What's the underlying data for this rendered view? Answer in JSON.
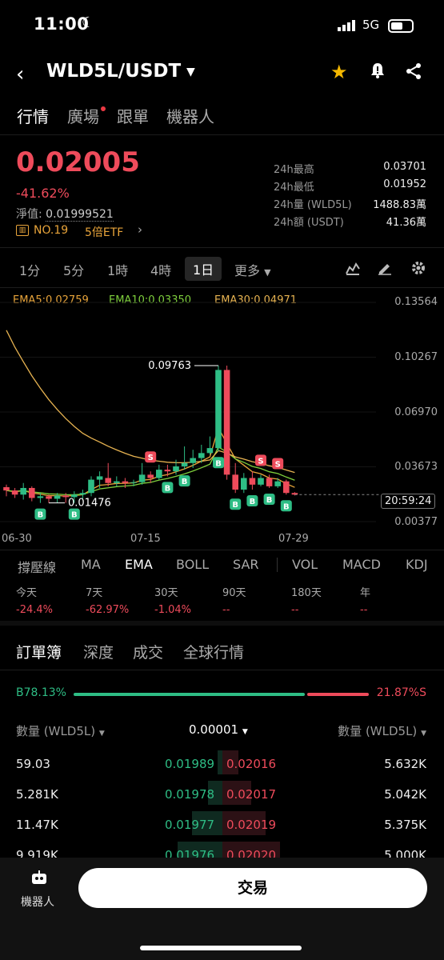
{
  "status_bar": {
    "time": "11:00",
    "network": "5G"
  },
  "header": {
    "pair": "WLD5L/USDT"
  },
  "tabs": [
    {
      "label": "行情",
      "active": true
    },
    {
      "label": "廣場",
      "active": false,
      "dot": true
    },
    {
      "label": "跟單",
      "active": false
    },
    {
      "label": "機器人",
      "active": false
    }
  ],
  "ticker": {
    "price": "0.02005",
    "change": "-41.62%",
    "nav_label": "淨值:",
    "nav_value": "0.01999521",
    "rank": "NO.19",
    "etf": "5倍ETF",
    "stats": [
      {
        "label": "24h最高",
        "value": "0.03701"
      },
      {
        "label": "24h最低",
        "value": "0.01952"
      },
      {
        "label": "24h量 (WLD5L)",
        "value": "1488.83萬"
      },
      {
        "label": "24h額 (USDT)",
        "value": "41.36萬"
      }
    ]
  },
  "intervals": [
    "1分",
    "5分",
    "1時",
    "4時",
    "1日",
    "更多"
  ],
  "active_interval": "1日",
  "chart": {
    "ema_labels": [
      "EMA5:0.02759",
      "EMA10:0.03350",
      "EMA30:0.04971"
    ],
    "ema_colors": [
      "#e8a43a",
      "#7ecf3c",
      "#e7b351"
    ],
    "y_ticks": [
      "0.13564",
      "0.10267",
      "0.06970",
      "0.03673",
      "0.00377"
    ],
    "x_ticks": [
      "06-30",
      "07-15",
      "07-29"
    ],
    "high_label": "0.09763",
    "low_label": "0.01476",
    "countdown": "20:59:24",
    "buy_marker": "B",
    "sell_marker": "S"
  },
  "chart_data": {
    "type": "candlestick",
    "ylim": [
      0.00377,
      0.13564
    ],
    "candles": [
      {
        "o": 0.0245,
        "c": 0.0225,
        "h": 0.026,
        "l": 0.019
      },
      {
        "o": 0.0225,
        "c": 0.02,
        "h": 0.024,
        "l": 0.018
      },
      {
        "o": 0.02,
        "c": 0.024,
        "h": 0.027,
        "l": 0.017
      },
      {
        "o": 0.024,
        "c": 0.018,
        "h": 0.025,
        "l": 0.016
      },
      {
        "o": 0.018,
        "c": 0.019,
        "h": 0.021,
        "l": 0.015
      },
      {
        "o": 0.019,
        "c": 0.0175,
        "h": 0.02,
        "l": 0.015
      },
      {
        "o": 0.0175,
        "c": 0.0195,
        "h": 0.021,
        "l": 0.015
      },
      {
        "o": 0.0195,
        "c": 0.0185,
        "h": 0.021,
        "l": 0.015
      },
      {
        "o": 0.0185,
        "c": 0.02,
        "h": 0.022,
        "l": 0.015
      },
      {
        "o": 0.02,
        "c": 0.021,
        "h": 0.023,
        "l": 0.017
      },
      {
        "o": 0.021,
        "c": 0.029,
        "h": 0.031,
        "l": 0.019
      },
      {
        "o": 0.029,
        "c": 0.031,
        "h": 0.034,
        "l": 0.024
      },
      {
        "o": 0.03,
        "c": 0.027,
        "h": 0.039,
        "l": 0.025
      },
      {
        "o": 0.027,
        "c": 0.028,
        "h": 0.031,
        "l": 0.025
      },
      {
        "o": 0.028,
        "c": 0.027,
        "h": 0.03,
        "l": 0.024
      },
      {
        "o": 0.027,
        "c": 0.0275,
        "h": 0.029,
        "l": 0.025
      },
      {
        "o": 0.0275,
        "c": 0.032,
        "h": 0.039,
        "l": 0.026
      },
      {
        "o": 0.032,
        "c": 0.03,
        "h": 0.034,
        "l": 0.027
      },
      {
        "o": 0.03,
        "c": 0.035,
        "h": 0.038,
        "l": 0.029
      },
      {
        "o": 0.035,
        "c": 0.034,
        "h": 0.038,
        "l": 0.031
      },
      {
        "o": 0.034,
        "c": 0.037,
        "h": 0.041,
        "l": 0.032
      },
      {
        "o": 0.037,
        "c": 0.039,
        "h": 0.049,
        "l": 0.035
      },
      {
        "o": 0.039,
        "c": 0.042,
        "h": 0.047,
        "l": 0.036
      },
      {
        "o": 0.042,
        "c": 0.045,
        "h": 0.05,
        "l": 0.039
      },
      {
        "o": 0.045,
        "c": 0.048,
        "h": 0.055,
        "l": 0.044
      },
      {
        "o": 0.048,
        "c": 0.095,
        "h": 0.0976,
        "l": 0.046
      },
      {
        "o": 0.095,
        "c": 0.032,
        "h": 0.0976,
        "l": 0.029
      },
      {
        "o": 0.032,
        "c": 0.023,
        "h": 0.039,
        "l": 0.021
      },
      {
        "o": 0.023,
        "c": 0.03,
        "h": 0.033,
        "l": 0.021
      },
      {
        "o": 0.03,
        "c": 0.026,
        "h": 0.034,
        "l": 0.023
      },
      {
        "o": 0.026,
        "c": 0.03,
        "h": 0.032,
        "l": 0.025
      },
      {
        "o": 0.03,
        "c": 0.025,
        "h": 0.032,
        "l": 0.024
      },
      {
        "o": 0.025,
        "c": 0.028,
        "h": 0.03,
        "l": 0.024
      },
      {
        "o": 0.028,
        "c": 0.021,
        "h": 0.029,
        "l": 0.02
      },
      {
        "o": 0.021,
        "c": 0.02,
        "h": 0.0215,
        "l": 0.0195
      }
    ]
  },
  "indicators": [
    "撐壓線",
    "MA",
    "EMA",
    "BOLL",
    "SAR",
    "VOL",
    "MACD",
    "KDJ"
  ],
  "active_indicator": "EMA",
  "performance": [
    {
      "label": "今天",
      "value": "-24.4%"
    },
    {
      "label": "7天",
      "value": "-62.97%"
    },
    {
      "label": "30天",
      "value": "-1.04%"
    },
    {
      "label": "90天",
      "value": "--"
    },
    {
      "label": "180天",
      "value": "--"
    },
    {
      "label": "年",
      "value": "--"
    }
  ],
  "orderbook": {
    "tabs": [
      "訂單簿",
      "深度",
      "成交",
      "全球行情"
    ],
    "buy_ratio": "B78.13%",
    "sell_ratio": "21.87%S",
    "buy_ratio_value": 78.13,
    "sell_ratio_value": 21.87,
    "col_qty_left": "數量 (WLD5L)",
    "col_step": "0.00001",
    "col_qty_right": "數量 (WLD5L)",
    "rows": [
      {
        "bid_qty": "59.03",
        "bid": "0.01989",
        "ask": "0.02016",
        "ask_qty": "5.632K"
      },
      {
        "bid_qty": "5.281K",
        "bid": "0.01978",
        "ask": "0.02017",
        "ask_qty": "5.042K"
      },
      {
        "bid_qty": "11.47K",
        "bid": "0.01977",
        "ask": "0.02019",
        "ask_qty": "5.375K"
      },
      {
        "bid_qty": "9.919K",
        "bid": "0.01976",
        "ask": "0.02020",
        "ask_qty": "5.000K"
      }
    ]
  },
  "bottom": {
    "robot_label": "機器人",
    "trade_label": "交易"
  }
}
